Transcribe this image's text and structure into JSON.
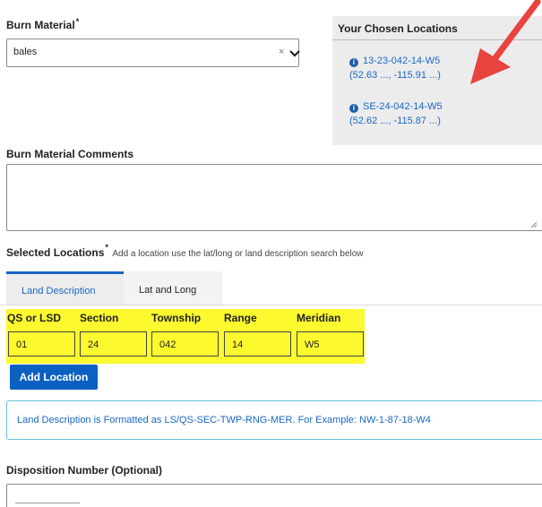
{
  "burn_material": {
    "label": "Burn Material",
    "required_mark": "*",
    "value": "bales",
    "clear_glyph": "×",
    "icons": {
      "chevron": "chevron-down-icon"
    }
  },
  "chosen_locations": {
    "title": "Your Chosen Locations",
    "items": [
      {
        "name": "13-23-042-14-W5",
        "coords": "(52.63 ..., -115.91 ...)"
      },
      {
        "name": "SE-24-042-14-W5",
        "coords": "(52.62 ..., -115.87 ...)"
      }
    ],
    "info_glyph": "i"
  },
  "burn_material_comments": {
    "label": "Burn Material Comments",
    "value": ""
  },
  "selected_locations": {
    "label": "Selected Locations",
    "required_mark": "*",
    "help": "Add a location use the lat/long or land description search below"
  },
  "tabs": [
    {
      "label": "Land Description",
      "active": true
    },
    {
      "label": "Lat and Long",
      "active": false
    }
  ],
  "land_description_fields": [
    {
      "label": "QS or LSD",
      "value": "01"
    },
    {
      "label": "Section",
      "value": "24"
    },
    {
      "label": "Township",
      "value": "042"
    },
    {
      "label": "Range",
      "value": "14"
    },
    {
      "label": "Meridian",
      "value": "W5"
    }
  ],
  "add_location_label": "Add Location",
  "format_info": "Land Description is Formatted as LS/QS-SEC-TWP-RNG-MER. For Example: NW-1-87-18-W4",
  "disposition_number": {
    "label": "Disposition Number (Optional)",
    "value": ""
  },
  "colors": {
    "highlight": "#fcf92f",
    "link": "#1a67c4",
    "button": "#0b61c2",
    "annotation_arrow": "#e8433e"
  }
}
